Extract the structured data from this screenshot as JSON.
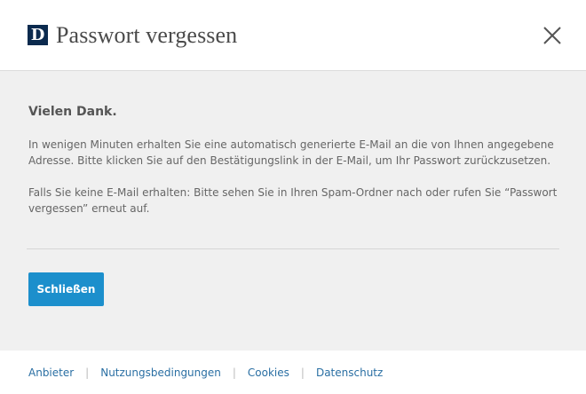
{
  "header": {
    "logo_letter": "D",
    "title": "Passwort vergessen",
    "close_icon": "close-icon"
  },
  "content": {
    "heading": "Vielen Dank.",
    "paragraph1": "In wenigen Minuten erhalten Sie eine automatisch generierte E-Mail an die von Ihnen angegebene Adresse. Bitte klicken Sie auf den Bestätigungslink in der E-Mail, um Ihr Passwort zurückzusetzen.",
    "paragraph2": "Falls Sie keine E-Mail erhalten: Bitte sehen Sie in Ihren Spam-Ordner nach oder rufen Sie “Passwort vergessen” erneut auf.",
    "close_button_label": "Schließen"
  },
  "footer": {
    "links": [
      "Anbieter",
      "Nutzungsbedingungen",
      "Cookies",
      "Datenschutz"
    ],
    "separator": "|"
  },
  "colors": {
    "logo_bg": "#0b2a4e",
    "button_bg": "#1c8fcc",
    "content_bg": "#f0f0f0",
    "link": "#2a6fa3"
  }
}
